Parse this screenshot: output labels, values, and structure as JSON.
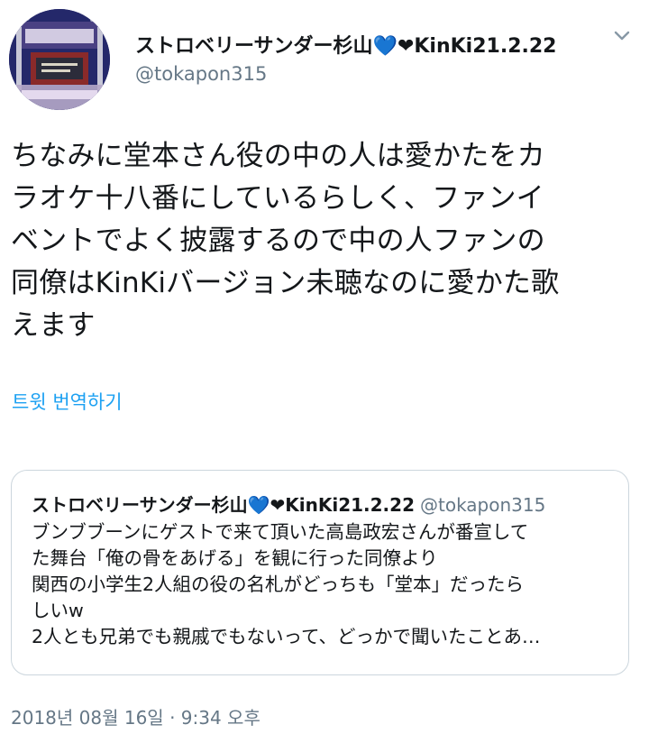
{
  "author": {
    "display_name": "ストロベリーサンダー杉山💙❤KinKi21.2.22",
    "username": "@tokapon315",
    "avatar_icon": "profile-avatar"
  },
  "menu": {
    "icon": "chevron-down-icon"
  },
  "tweet": {
    "text": "ちなみに堂本さん役の中の人は愛かたをカ\nラオケ十八番にしているらしく、ファンイ\nベントでよく披露するので中の人ファンの\n同僚はKinKiバージョン未聴なのに愛かた歌\nえます",
    "translate_label": "트윗 번역하기",
    "timestamp": "2018년 08월 16일 · 9:34 오후"
  },
  "quoted_tweet": {
    "display_name": "ストロベリーサンダー杉山💙❤KinKi21.2.22",
    "username": "@tokapon315",
    "text": "ブンブブーンにゲストで来て頂いた高島政宏さんが番宣して\nた舞台「俺の骨をあげる」を観に行った同僚より\n関西の小学生2人組の役の名札がどっちも「堂本」だったら\nしいw\n2人とも兄弟でも親戚でもないって、どっかで聞いたことあ…"
  },
  "colors": {
    "text_primary": "#14171a",
    "text_secondary": "#657786",
    "link": "#1da1f2",
    "border": "#ccd6dd"
  }
}
